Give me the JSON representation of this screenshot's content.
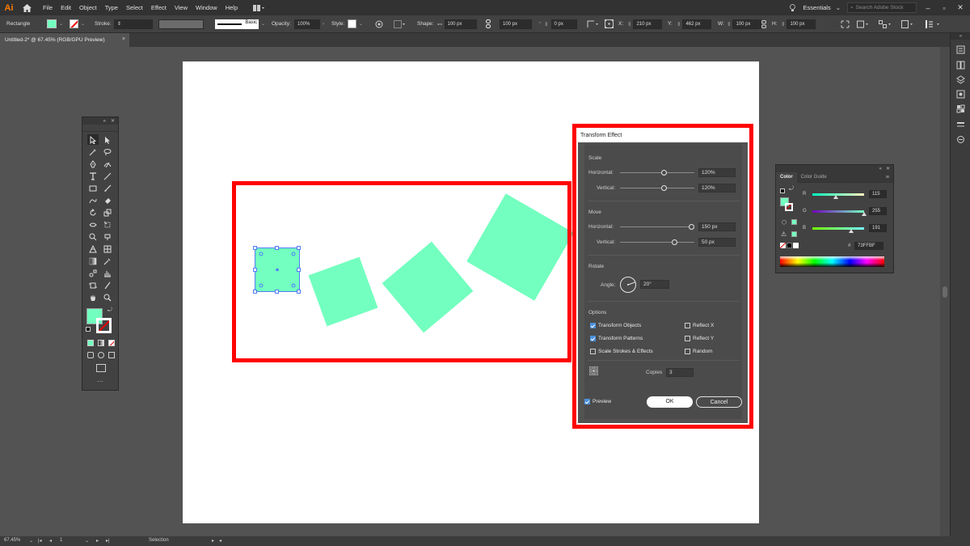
{
  "app": {
    "logo": "Ai",
    "menu": [
      "File",
      "Edit",
      "Object",
      "Type",
      "Select",
      "Effect",
      "View",
      "Window",
      "Help"
    ],
    "workspace": "Essentials",
    "stock_search_placeholder": "Search Adobe Stock"
  },
  "controlbar": {
    "tool_name": "Rectangle",
    "stroke_label": "Stroke:",
    "brush": "Basic",
    "opacity_label": "Opacity:",
    "opacity": "100%",
    "style_label": "Style:",
    "shape_label": "Shape:",
    "shape_w": "100 px",
    "shape_h": "100 px",
    "corner": "0 px",
    "x_label": "X:",
    "x": "210 px",
    "y_label": "Y:",
    "y": "462 px",
    "w_label": "W:",
    "w": "100 px",
    "h_label": "H:",
    "h": "100 px"
  },
  "document": {
    "tab_title": "Untitled-2* @ 67.45% (RGB/GPU Preview)",
    "close": "×"
  },
  "art": {
    "fill_color": "#73FFBF",
    "selection_color": "#4f7df7",
    "highlight_color": "#ff0000"
  },
  "color_panel": {
    "tabs": [
      "Color",
      "Color Guide"
    ],
    "r_label": "R",
    "r": "115",
    "g_label": "G",
    "g": "255",
    "b_label": "B",
    "b": "191",
    "hex_label": "#",
    "hex": "73FFBF",
    "r_fraction": 0.451,
    "g_fraction": 1.0,
    "b_fraction": 0.749
  },
  "dialog": {
    "title": "Transform Effect",
    "scale_label": "Scale",
    "scale_h_label": "Horizontal:",
    "scale_h": "120%",
    "scale_v_label": "Vertical:",
    "scale_v": "120%",
    "move_label": "Move",
    "move_h_label": "Horizontal:",
    "move_h": "150 px",
    "move_v_label": "Vertical:",
    "move_v": "50 px",
    "rotate_label": "Rotate",
    "angle_label": "Angle:",
    "angle": "20°",
    "options_label": "Options",
    "opt_transform_objects": "Transform Objects",
    "opt_transform_patterns": "Transform Patterns",
    "opt_scale_strokes": "Scale Strokes & Effects",
    "opt_reflect_x": "Reflect X",
    "opt_reflect_y": "Reflect Y",
    "opt_random": "Random",
    "copies_label": "Copies",
    "copies": "3",
    "preview_label": "Preview",
    "ok_label": "OK",
    "cancel_label": "Cancel"
  },
  "statusbar": {
    "zoom": "67.45%",
    "artboard_num": "1",
    "tool": "Selection"
  }
}
